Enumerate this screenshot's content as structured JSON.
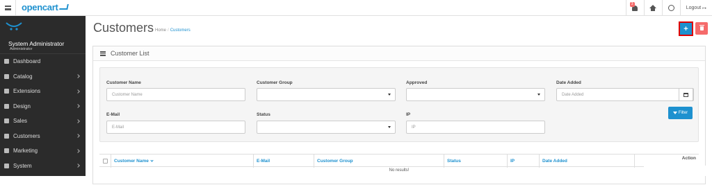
{
  "header": {
    "logo": "opencart",
    "notification_count": "3",
    "logout_label": "Logout"
  },
  "sidebar": {
    "user_name": "System Administrator",
    "user_role": "Administrator",
    "items": [
      {
        "label": "Dashboard",
        "icon": "dashboard-icon",
        "has_submenu": false
      },
      {
        "label": "Catalog",
        "icon": "tag-icon",
        "has_submenu": true
      },
      {
        "label": "Extensions",
        "icon": "puzzle-icon",
        "has_submenu": true
      },
      {
        "label": "Design",
        "icon": "monitor-icon",
        "has_submenu": true
      },
      {
        "label": "Sales",
        "icon": "cart-icon",
        "has_submenu": true
      },
      {
        "label": "Customers",
        "icon": "user-icon",
        "has_submenu": true
      },
      {
        "label": "Marketing",
        "icon": "share-icon",
        "has_submenu": true
      },
      {
        "label": "System",
        "icon": "cog-icon",
        "has_submenu": true
      }
    ]
  },
  "page": {
    "title": "Customers",
    "breadcrumb": [
      "Home",
      "Customers"
    ],
    "add_button": "+",
    "colors": {
      "primary": "#1e91cf",
      "danger": "#f56b6b",
      "highlight": "#e00000"
    }
  },
  "panel": {
    "title": "Customer List"
  },
  "filters": {
    "customer_name": {
      "label": "Customer Name",
      "placeholder": "Customer Name"
    },
    "customer_group": {
      "label": "Customer Group",
      "value": ""
    },
    "approved": {
      "label": "Approved",
      "value": ""
    },
    "date_added": {
      "label": "Date Added",
      "placeholder": "Date Added"
    },
    "email": {
      "label": "E-Mail",
      "placeholder": "E-Mail"
    },
    "status": {
      "label": "Status",
      "value": ""
    },
    "ip": {
      "label": "IP",
      "placeholder": "IP"
    },
    "filter_button": "Filter"
  },
  "table": {
    "columns": [
      "Customer Name",
      "E-Mail",
      "Customer Group",
      "Status",
      "IP",
      "Date Added",
      "Action"
    ],
    "empty_text": "No results!"
  }
}
